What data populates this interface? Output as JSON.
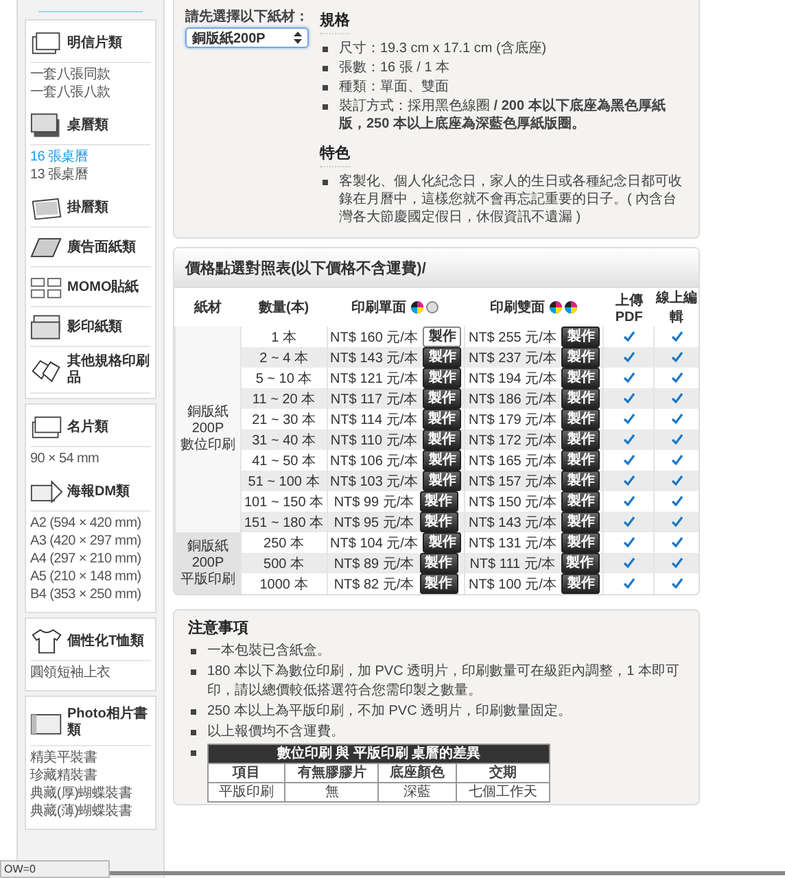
{
  "sidebar": {
    "cards": [
      {
        "categories": [
          {
            "label": "明信片類",
            "items": [
              {
                "label": "一套八張同款",
                "selected": false
              },
              {
                "label": "一套八張八款",
                "selected": false
              }
            ]
          },
          {
            "label": "桌曆類",
            "items": [
              {
                "label": "16 張桌曆",
                "selected": true
              },
              {
                "label": "13 張桌曆",
                "selected": false
              }
            ]
          },
          {
            "label": "掛曆類"
          },
          {
            "label": "廣告面紙類"
          },
          {
            "label": "MOMO貼紙"
          },
          {
            "label": "影印紙類"
          },
          {
            "label": "其他規格印刷品"
          }
        ]
      },
      {
        "categories": [
          {
            "label": "名片類",
            "items": [
              {
                "label": "90 × 54 mm",
                "selected": false
              }
            ]
          },
          {
            "label": "海報DM類",
            "items": [
              {
                "label": "A2 (594 × 420 mm)",
                "selected": false
              },
              {
                "label": "A3 (420 × 297 mm)",
                "selected": false
              },
              {
                "label": "A4 (297 × 210 mm)",
                "selected": false
              },
              {
                "label": "A5 (210 × 148 mm)",
                "selected": false
              },
              {
                "label": "B4 (353 × 250 mm)",
                "selected": false
              }
            ]
          }
        ]
      },
      {
        "categories": [
          {
            "label": "個性化T恤類",
            "items": [
              {
                "label": "圓領短袖上衣",
                "selected": false
              }
            ]
          }
        ]
      },
      {
        "categories": [
          {
            "label": "Photo相片書類",
            "items": [
              {
                "label": "精美平裝書",
                "selected": false
              },
              {
                "label": "珍藏精裝書",
                "selected": false
              },
              {
                "label": "典藏(厚)蝴蝶裝書",
                "selected": false
              },
              {
                "label": "典藏(薄)蝴蝶裝書",
                "selected": false
              }
            ]
          }
        ]
      }
    ]
  },
  "material_picker": {
    "label": "請先選擇以下紙材：",
    "value": "銅版紙200P"
  },
  "specs": {
    "heading": "規格",
    "bullets": [
      "尺寸：19.3 cm x 17.1 cm (含底座)",
      "張數：16 張 / 1 本",
      "種類：單面、雙面",
      "裝訂方式：採用黑色線圈 **/ 200 本以下底座為黑色厚紙版，250 本以上底座為深藍色厚紙版圈。**"
    ]
  },
  "features": {
    "heading": "特色",
    "bullets": [
      "客製化、個人化紀念日，家人的生日或各種紀念日都可收錄在月曆中，這樣您就不會再忘記重要的日子。( 內含台灣各大節慶國定假日，休假資訊不遺漏 )"
    ]
  },
  "price_table": {
    "title": "價格點選對照表(以下價格不含運費)/",
    "columns": [
      "紙材",
      "數量(本)",
      "印刷單面",
      "印刷雙面",
      "上傳 PDF",
      "線上編輯"
    ],
    "groups": [
      {
        "material": "銅版紙200P",
        "method": "數位印刷",
        "rows": [
          {
            "qty": "1 本",
            "single": "NT$ 160 元/本",
            "single_button": {
              "label": "製作",
              "selected": true
            },
            "double": "NT$ 255 元/本",
            "double_button": {
              "label": "製作",
              "selected": false
            },
            "pdf": true,
            "online_edit": true
          },
          {
            "qty": "2 ~ 4 本",
            "single": "NT$ 143 元/本",
            "single_button": {
              "label": "製作",
              "selected": false
            },
            "double": "NT$ 237 元/本",
            "double_button": {
              "label": "製作",
              "selected": false
            },
            "pdf": true,
            "online_edit": true
          },
          {
            "qty": "5 ~ 10 本",
            "single": "NT$ 121 元/本",
            "single_button": {
              "label": "製作",
              "selected": false
            },
            "double": "NT$ 194 元/本",
            "double_button": {
              "label": "製作",
              "selected": false
            },
            "pdf": true,
            "online_edit": true
          },
          {
            "qty": "11 ~ 20 本",
            "single": "NT$ 117 元/本",
            "single_button": {
              "label": "製作",
              "selected": false
            },
            "double": "NT$ 186 元/本",
            "double_button": {
              "label": "製作",
              "selected": false
            },
            "pdf": true,
            "online_edit": true
          },
          {
            "qty": "21 ~ 30 本",
            "single": "NT$ 114 元/本",
            "single_button": {
              "label": "製作",
              "selected": false
            },
            "double": "NT$ 179 元/本",
            "double_button": {
              "label": "製作",
              "selected": false
            },
            "pdf": true,
            "online_edit": true
          },
          {
            "qty": "31 ~ 40 本",
            "single": "NT$ 110 元/本",
            "single_button": {
              "label": "製作",
              "selected": false
            },
            "double": "NT$ 172 元/本",
            "double_button": {
              "label": "製作",
              "selected": false
            },
            "pdf": true,
            "online_edit": true
          },
          {
            "qty": "41 ~ 50 本",
            "single": "NT$ 106 元/本",
            "single_button": {
              "label": "製作",
              "selected": false
            },
            "double": "NT$ 165 元/本",
            "double_button": {
              "label": "製作",
              "selected": false
            },
            "pdf": true,
            "online_edit": true
          },
          {
            "qty": "51 ~ 100 本",
            "single": "NT$ 103 元/本",
            "single_button": {
              "label": "製作",
              "selected": false
            },
            "double": "NT$ 157 元/本",
            "double_button": {
              "label": "製作",
              "selected": false
            },
            "pdf": true,
            "online_edit": true
          },
          {
            "qty": "101 ~ 150 本",
            "single": "NT$ 99 元/本",
            "single_button": {
              "label": "製作",
              "selected": false
            },
            "double": "NT$ 150 元/本",
            "double_button": {
              "label": "製作",
              "selected": false
            },
            "pdf": true,
            "online_edit": true
          },
          {
            "qty": "151 ~ 180 本",
            "single": "NT$ 95 元/本",
            "single_button": {
              "label": "製作",
              "selected": false
            },
            "double": "NT$ 143 元/本",
            "double_button": {
              "label": "製作",
              "selected": false
            },
            "pdf": true,
            "online_edit": true
          }
        ]
      },
      {
        "material": "銅版紙200P",
        "method": "平版印刷",
        "rows": [
          {
            "qty": "250 本",
            "single": "NT$ 104 元/本",
            "single_button": {
              "label": "製作",
              "selected": false
            },
            "double": "NT$ 131 元/本",
            "double_button": {
              "label": "製作",
              "selected": false
            },
            "pdf": true,
            "online_edit": true
          },
          {
            "qty": "500 本",
            "single": "NT$ 89 元/本",
            "single_button": {
              "label": "製作",
              "selected": false
            },
            "double": "NT$ 111 元/本",
            "double_button": {
              "label": "製作",
              "selected": false
            },
            "pdf": true,
            "online_edit": true
          },
          {
            "qty": "1000 本",
            "single": "NT$ 82 元/本",
            "single_button": {
              "label": "製作",
              "selected": false
            },
            "double": "NT$ 100 元/本",
            "double_button": {
              "label": "製作",
              "selected": false
            },
            "pdf": true,
            "online_edit": true
          }
        ]
      }
    ]
  },
  "notes": {
    "heading": "注意事項",
    "bullets": [
      {
        "kind": "text",
        "text": "一本包裝已含紙盒。"
      },
      {
        "kind": "text",
        "text": "180 本以下為數位印刷，加 PVC 透明片，印刷數量可在級距內調整，1 本即可印，請以總價較低搭選符合您需印製之數量。"
      },
      {
        "kind": "text",
        "text": "250 本以上為平版印刷，不加 PVC 透明片，印刷數量固定。"
      },
      {
        "kind": "text",
        "text": "以上報價均不含運費。"
      },
      {
        "kind": "table",
        "title": "數位印刷 與 平版印刷 桌曆的差異",
        "columns": [
          "項目",
          "有無膠膠片",
          "底座顏色",
          "交期"
        ],
        "rows": [
          [
            "平版印刷",
            "無",
            "深藍",
            "七個工作天"
          ]
        ]
      }
    ]
  },
  "status_bar": {
    "text": "OW=0"
  }
}
